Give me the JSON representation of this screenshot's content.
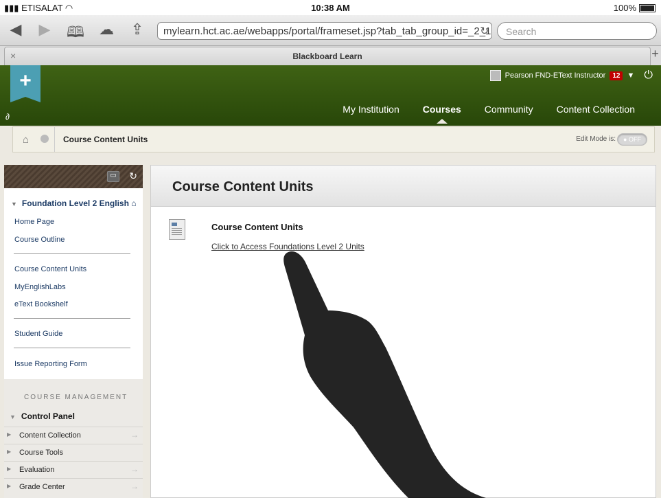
{
  "status_bar": {
    "carrier": "ETISALAT",
    "time": "10:38 AM",
    "battery": "100%"
  },
  "browser": {
    "url": "mylearn.hct.ac.ae/webapps/portal/frameset.jsp?tab_tab_group_id=_2_1",
    "search_placeholder": "Search",
    "tab_title": "Blackboard Learn",
    "tab_close": "×",
    "new_tab": "+"
  },
  "header": {
    "user_name": "Pearson FND-EText Instructor",
    "notification_count": "12",
    "nav": [
      "My Institution",
      "Courses",
      "Community",
      "Content Collection"
    ],
    "active_nav": "Courses"
  },
  "breadcrumb": {
    "current": "Course Content Units",
    "edit_mode_label": "Edit Mode is:",
    "edit_mode_value": "OFF"
  },
  "sidebar": {
    "course_title": "Foundation Level 2 English",
    "group1": [
      "Home Page",
      "Course Outline"
    ],
    "group2": [
      "Course Content Units",
      "MyEnglishLabs",
      "eText Bookshelf"
    ],
    "group3": [
      "Student Guide"
    ],
    "group4": [
      "Issue Reporting Form"
    ],
    "management": {
      "heading": "COURSE MANAGEMENT",
      "control_panel": "Control Panel",
      "items": [
        "Content Collection",
        "Course Tools",
        "Evaluation",
        "Grade Center"
      ]
    }
  },
  "content": {
    "page_title": "Course Content Units",
    "item_title": "Course Content Units",
    "item_link": "Click to Access Foundations Level 2 Units"
  },
  "colors": {
    "header_green": "#335510",
    "logo_teal": "#4c9fb3",
    "link_navy": "#1b3a64",
    "badge_red": "#c20000"
  }
}
